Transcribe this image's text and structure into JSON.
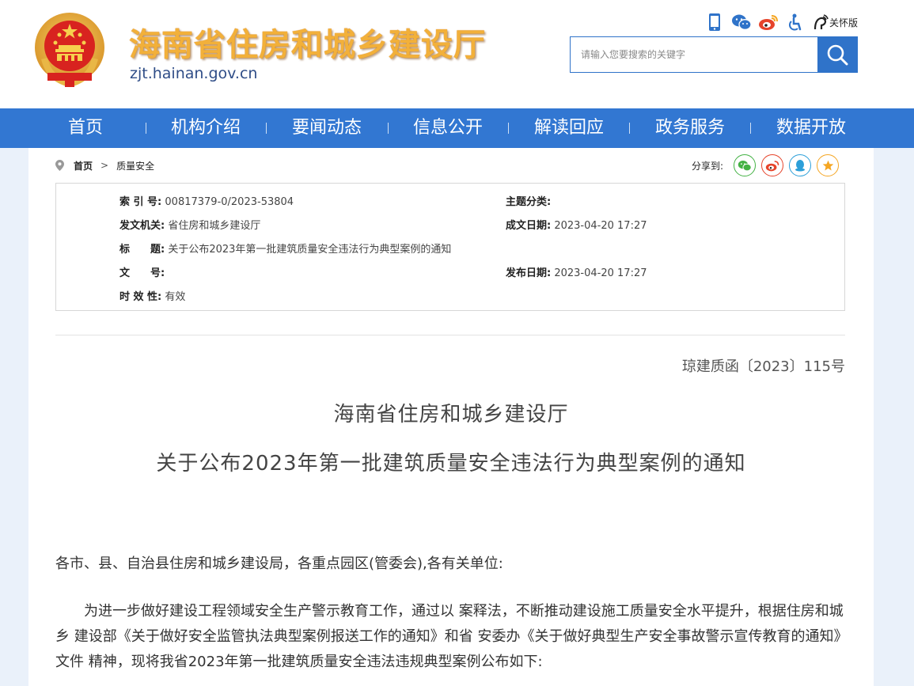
{
  "header": {
    "site_title": "海南省住房和城乡建设厅",
    "site_domain": "zjt.hainan.gov.cn",
    "care_mode_label": "关怀版",
    "top_icons": [
      "mobile-icon",
      "wechat-icon",
      "weibo-icon",
      "accessibility-icon",
      "care-mode-icon"
    ],
    "search": {
      "placeholder": "请输入您要搜索的关键字"
    }
  },
  "nav": {
    "items": [
      {
        "label": "首页"
      },
      {
        "label": "机构介绍"
      },
      {
        "label": "要闻动态"
      },
      {
        "label": "信息公开"
      },
      {
        "label": "解读回应"
      },
      {
        "label": "政务服务"
      },
      {
        "label": "数据开放"
      }
    ]
  },
  "breadcrumb": {
    "home": "首页",
    "separator": ">",
    "current": "质量安全"
  },
  "share": {
    "label": "分享到:",
    "targets": [
      {
        "name": "wechat",
        "color": "#43b244"
      },
      {
        "name": "weibo",
        "color": "#e6442b"
      },
      {
        "name": "qq",
        "color": "#2c9fd9"
      },
      {
        "name": "favorite",
        "color": "#f5a623"
      }
    ]
  },
  "meta": {
    "index_label": "索 引 号:",
    "index_value": "00817379-0/2023-53804",
    "topic_label": "主题分类:",
    "topic_value": "",
    "issuer_label": "发文机关:",
    "issuer_value": "省住房和城乡建设厅",
    "created_label": "成文日期:",
    "created_value": "2023-04-20 17:27",
    "title_label": "标　　题:",
    "title_value": "关于公布2023年第一批建筑质量安全违法行为典型案例的通知",
    "docno_label": "文　　号:",
    "docno_value": "",
    "published_label": "发布日期:",
    "published_value": "2023-04-20 17:27",
    "validity_label": "时 效 性:",
    "validity_value": "有效"
  },
  "document": {
    "number": "琼建质函〔2023〕115号",
    "issuer": "海南省住房和城乡建设厅",
    "title": "关于公布2023年第一批建筑质量安全违法行为典型案例的通知",
    "salutation": "各市、县、自治县住房和城乡建设局，各重点园区(管委会),各有关单位:",
    "paragraph1": "为进一步做好建设工程领域安全生产警示教育工作，通过以 案释法，不断推动建设施工质量安全水平提升，根据住房和城乡 建设部《关于做好安全监管执法典型案例报送工作的通知》和省 安委办《关于做好典型生产安全事故警示宣传教育的通知》文件 精神，现将我省2023年第一批建筑质量安全违法违规典型案例公布如下:"
  },
  "colors": {
    "brand_blue": "#3277d2",
    "title_gold": "#f2b03a",
    "domain_blue": "#2f4d87"
  }
}
